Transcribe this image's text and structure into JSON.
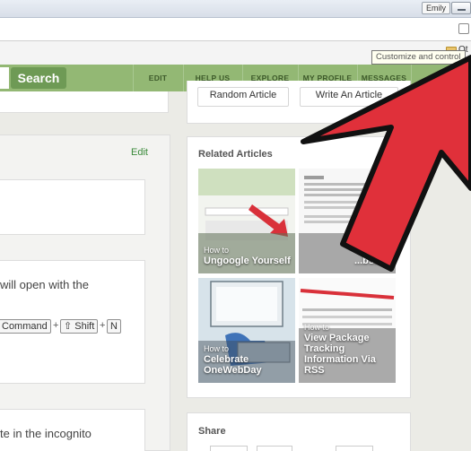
{
  "browser": {
    "user_name": "Emily",
    "tooltip": "Customize and control",
    "bookmark_label": "Ot"
  },
  "header": {
    "search_label": "Search",
    "nav": [
      "EDIT",
      "HELP US",
      "EXPLORE",
      "MY PROFILE",
      "MESSAGES"
    ]
  },
  "left": {
    "edit_label": "Edit",
    "step_text_1": "will open with the",
    "keys": [
      "Command",
      "⇧ Shift",
      "N"
    ],
    "plus": "+",
    "step_text_2": "te in the incognito"
  },
  "sidebar": {
    "buttons": [
      "Random Article",
      "Write An Article"
    ],
    "related_title": "Related Articles",
    "articles": [
      {
        "how": "How to",
        "title": "Ungoogle Yourself"
      },
      {
        "how": "How to",
        "title": "...bsite"
      },
      {
        "how": "How to",
        "title": "Celebrate OneWebDay"
      },
      {
        "how": "How to",
        "title": "View Package Tracking Information Via RSS"
      }
    ],
    "share_title": "Share"
  },
  "colors": {
    "header_green": "#93b874",
    "search_green": "#6e9a55",
    "arrow_red": "#e0303a"
  }
}
